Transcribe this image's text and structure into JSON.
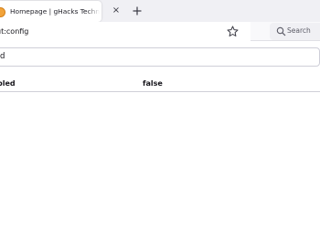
{
  "tabs": [
    {
      "title": "Homepage | gHacks Technology News",
      "favicon": "ghacks-favicon-icon",
      "active": true
    }
  ],
  "tab_close_glyph": "×",
  "new_tab_icon": "plus-icon",
  "address_bar": {
    "url": "about:config",
    "visible_text": "ut:config",
    "bookmark_icon": "star-icon"
  },
  "search_bar": {
    "placeholder": "Search",
    "icon": "search-icon"
  },
  "config_filter": {
    "visible_text": "d"
  },
  "preferences": [
    {
      "name_visible": "bled",
      "value": "false"
    }
  ],
  "colors": {
    "tabstrip_bg": "#f0f0f4",
    "favicon": "#f2a33a",
    "row_border": "#cfcfd8",
    "text": "#15141a"
  }
}
